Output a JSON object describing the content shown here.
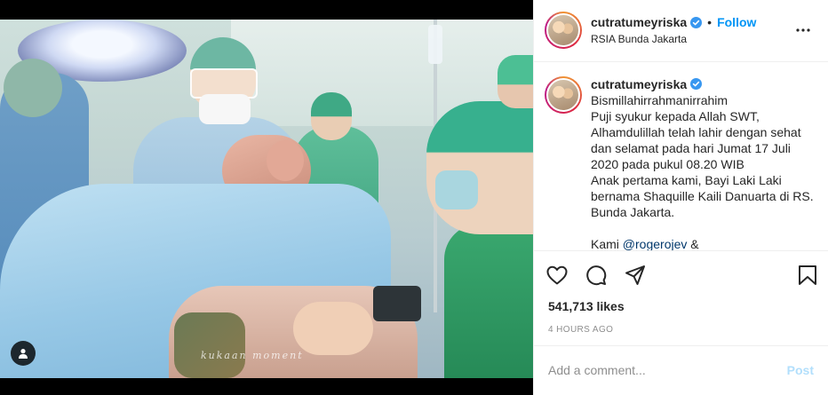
{
  "post": {
    "username": "cutratumeyriska",
    "verified": true,
    "follow_label": "Follow",
    "separator": "•",
    "location": "RSIA Bunda Jakarta",
    "more_icon": "more-options-icon"
  },
  "media": {
    "watermark": "kukaan moment",
    "tag_icon": "user-tag-icon"
  },
  "caption": {
    "username": "cutratumeyriska",
    "text": "Bismillahirrahmanirrahim\nPuji syukur kepada Allah SWT, Alhamdulillah telah lahir dengan sehat dan selamat pada hari Jumat 17 Juli 2020 pada pukul 08.20 WIB\nAnak pertama kami, Bayi Laki Laki bernama Shaquille Kaili Danuarta di RS. Bunda Jakarta.\n\nKami ",
    "mention": "@rogerojev",
    "tail": " &"
  },
  "actions": {
    "like_icon": "heart-icon",
    "comment_icon": "comment-icon",
    "share_icon": "share-icon",
    "save_icon": "bookmark-icon"
  },
  "likes": "541,713 likes",
  "timestamp": "4 HOURS AGO",
  "comment": {
    "placeholder": "Add a comment...",
    "post_label": "Post"
  },
  "colors": {
    "accent": "#0095f6",
    "post_disabled": "#b2dffc",
    "muted": "#8e8e8e"
  }
}
